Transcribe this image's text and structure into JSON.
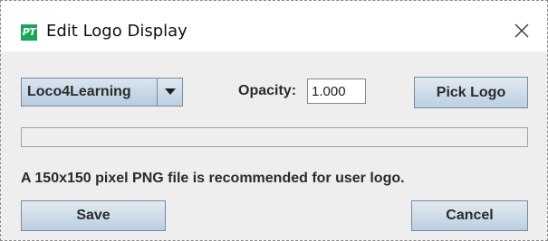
{
  "window": {
    "title": "Edit Logo Display",
    "app_icon_text": "PT",
    "close_icon": "close-icon"
  },
  "logo_selector": {
    "selected": "Loco4Learning",
    "arrow_icon": "chevron-down-icon"
  },
  "opacity": {
    "label": "Opacity:",
    "value": "1.000"
  },
  "buttons": {
    "pick_logo": "Pick Logo",
    "save": "Save",
    "cancel": "Cancel"
  },
  "progress": {
    "value": 0
  },
  "info": {
    "text": "A 150x150 pixel PNG file is recommended for user logo."
  },
  "colors": {
    "app_icon": "#1aa55a",
    "button_gradient_top": "#e2eaf2",
    "button_gradient_bottom": "#bccfe1",
    "content_bg": "#eeeeee"
  }
}
